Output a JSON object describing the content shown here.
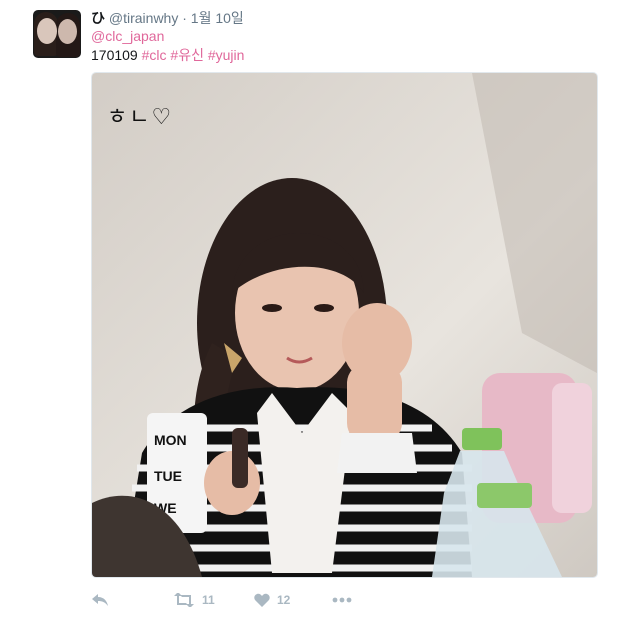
{
  "tweet": {
    "fullname": "ひ",
    "username": "@tirainwhy",
    "separator": "·",
    "date": "1월 10일",
    "mention": "@clc_japan",
    "text_prefix": "170109 ",
    "hashtags": [
      "#clc",
      "#유신",
      "#yujin"
    ],
    "photo_caption": "ㅎㄴ♡"
  },
  "actions": {
    "reply_icon": "reply-icon",
    "retweet_icon": "retweet-icon",
    "retweet_count": "11",
    "like_icon": "heart-icon",
    "like_count": "12",
    "more_icon": "more-dots-icon"
  },
  "colors": {
    "link": "#e0689b",
    "muted": "#657786",
    "action_gray": "#aab8c2"
  }
}
